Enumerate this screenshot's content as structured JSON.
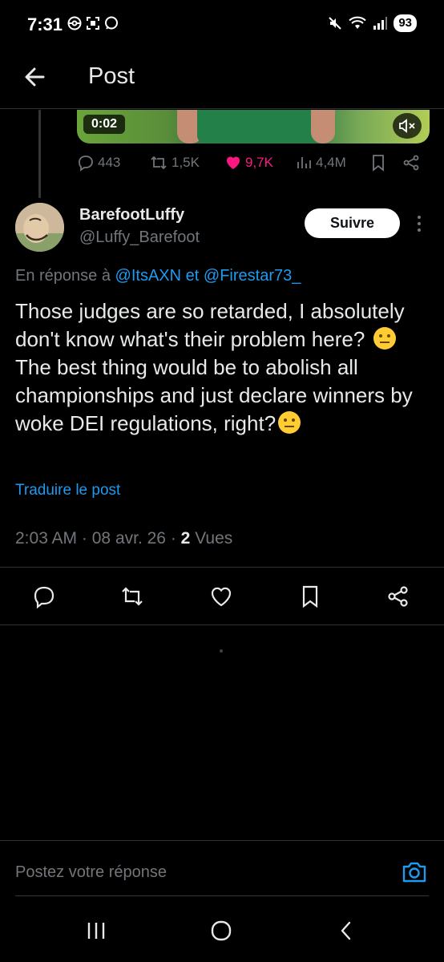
{
  "status_bar": {
    "time": "7:31",
    "battery": "93",
    "icons": [
      "pokeball-icon",
      "screenshot-icon",
      "chat-bubble-icon",
      "mute-icon",
      "wifi-icon",
      "signal-icon",
      "battery-icon"
    ]
  },
  "header": {
    "back_icon": "arrow-left-icon",
    "title": "Post"
  },
  "quoted_video": {
    "duration": "0:02",
    "mute_icon": "volume-muted-icon"
  },
  "quoted_actions": {
    "replies": "443",
    "reposts": "1,5K",
    "likes": "9,7K",
    "views": "4,4M"
  },
  "post": {
    "author_name": "BarefootLuffy",
    "author_handle": "@Luffy_Barefoot",
    "follow_label": "Suivre",
    "reply_prefix": "En réponse à",
    "reply_mention_1": "@ItsAXN",
    "reply_joiner": "et",
    "reply_mention_2": "@Firestar73_",
    "text_part_1": "Those judges are so retarded, I absolutely don't know what's their problem here?",
    "text_part_2": "The best thing would be to abolish all championships and just declare winners by woke DEI regulations, right?",
    "emoji_1": "neutral-face-emoji",
    "emoji_2": "expressionless-face-emoji",
    "translate_label": "Traduire le post",
    "time": "2:03 AM",
    "date": "08 avr. 26",
    "views_count": "2",
    "views_label": "Vues",
    "separator": "·"
  },
  "reply_composer": {
    "placeholder": "Postez votre réponse",
    "camera_icon": "camera-icon"
  },
  "colors": {
    "background": "#000000",
    "text_primary": "#e7e9ea",
    "text_secondary": "#71767b",
    "link": "#1d9bf0",
    "like": "#f91880",
    "divider": "#2f3336"
  }
}
